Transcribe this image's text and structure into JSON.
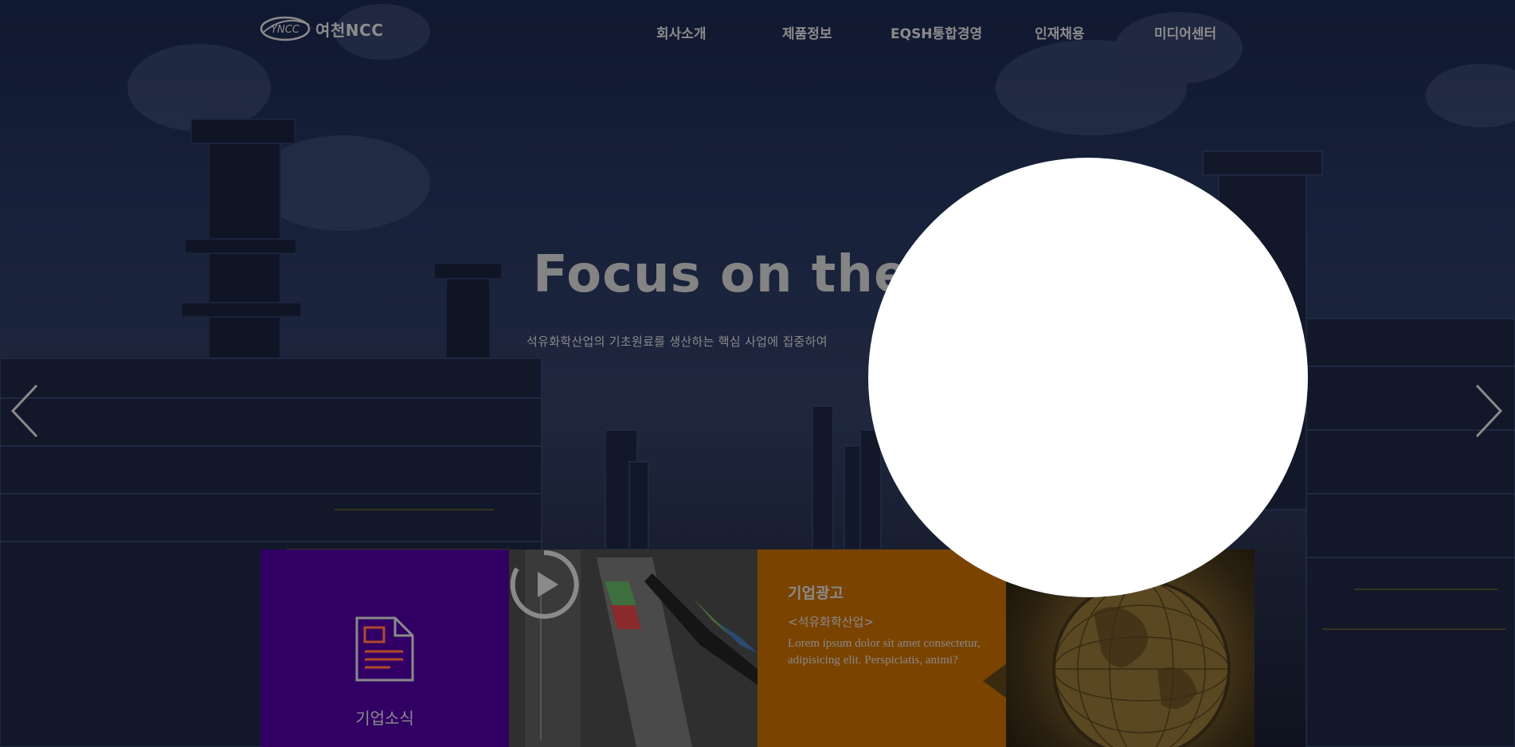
{
  "header": {
    "logo": {
      "mark_text": "YNCC",
      "name": "여천NCC"
    },
    "nav": [
      {
        "label": "회사소개"
      },
      {
        "label": "제품정보"
      },
      {
        "label": "EQSH통합경영"
      },
      {
        "label": "인재채용"
      },
      {
        "label": "미디어센터"
      }
    ]
  },
  "hero": {
    "title": "Focus on the b",
    "subtitle": "석유화학산업의 기초원료를 생산하는 핵심 사업에 집중하여"
  },
  "icons": {
    "prev": "chevron-left-icon",
    "next": "chevron-right-icon",
    "document": "document-icon",
    "play": "play-icon"
  },
  "panels": {
    "news": {
      "label": "기업소식"
    },
    "video": {
      "label": ""
    },
    "ad": {
      "heading": "기업광고",
      "subheading": "<석유화학산업>",
      "body": "Lorem ipsum dolor sit amet consectetur, adipisicing elit. Perspiciatis, animi?"
    }
  },
  "colors": {
    "news_panel": "#320064",
    "ad_panel": "#7a4300",
    "popup": "#ffffff"
  }
}
